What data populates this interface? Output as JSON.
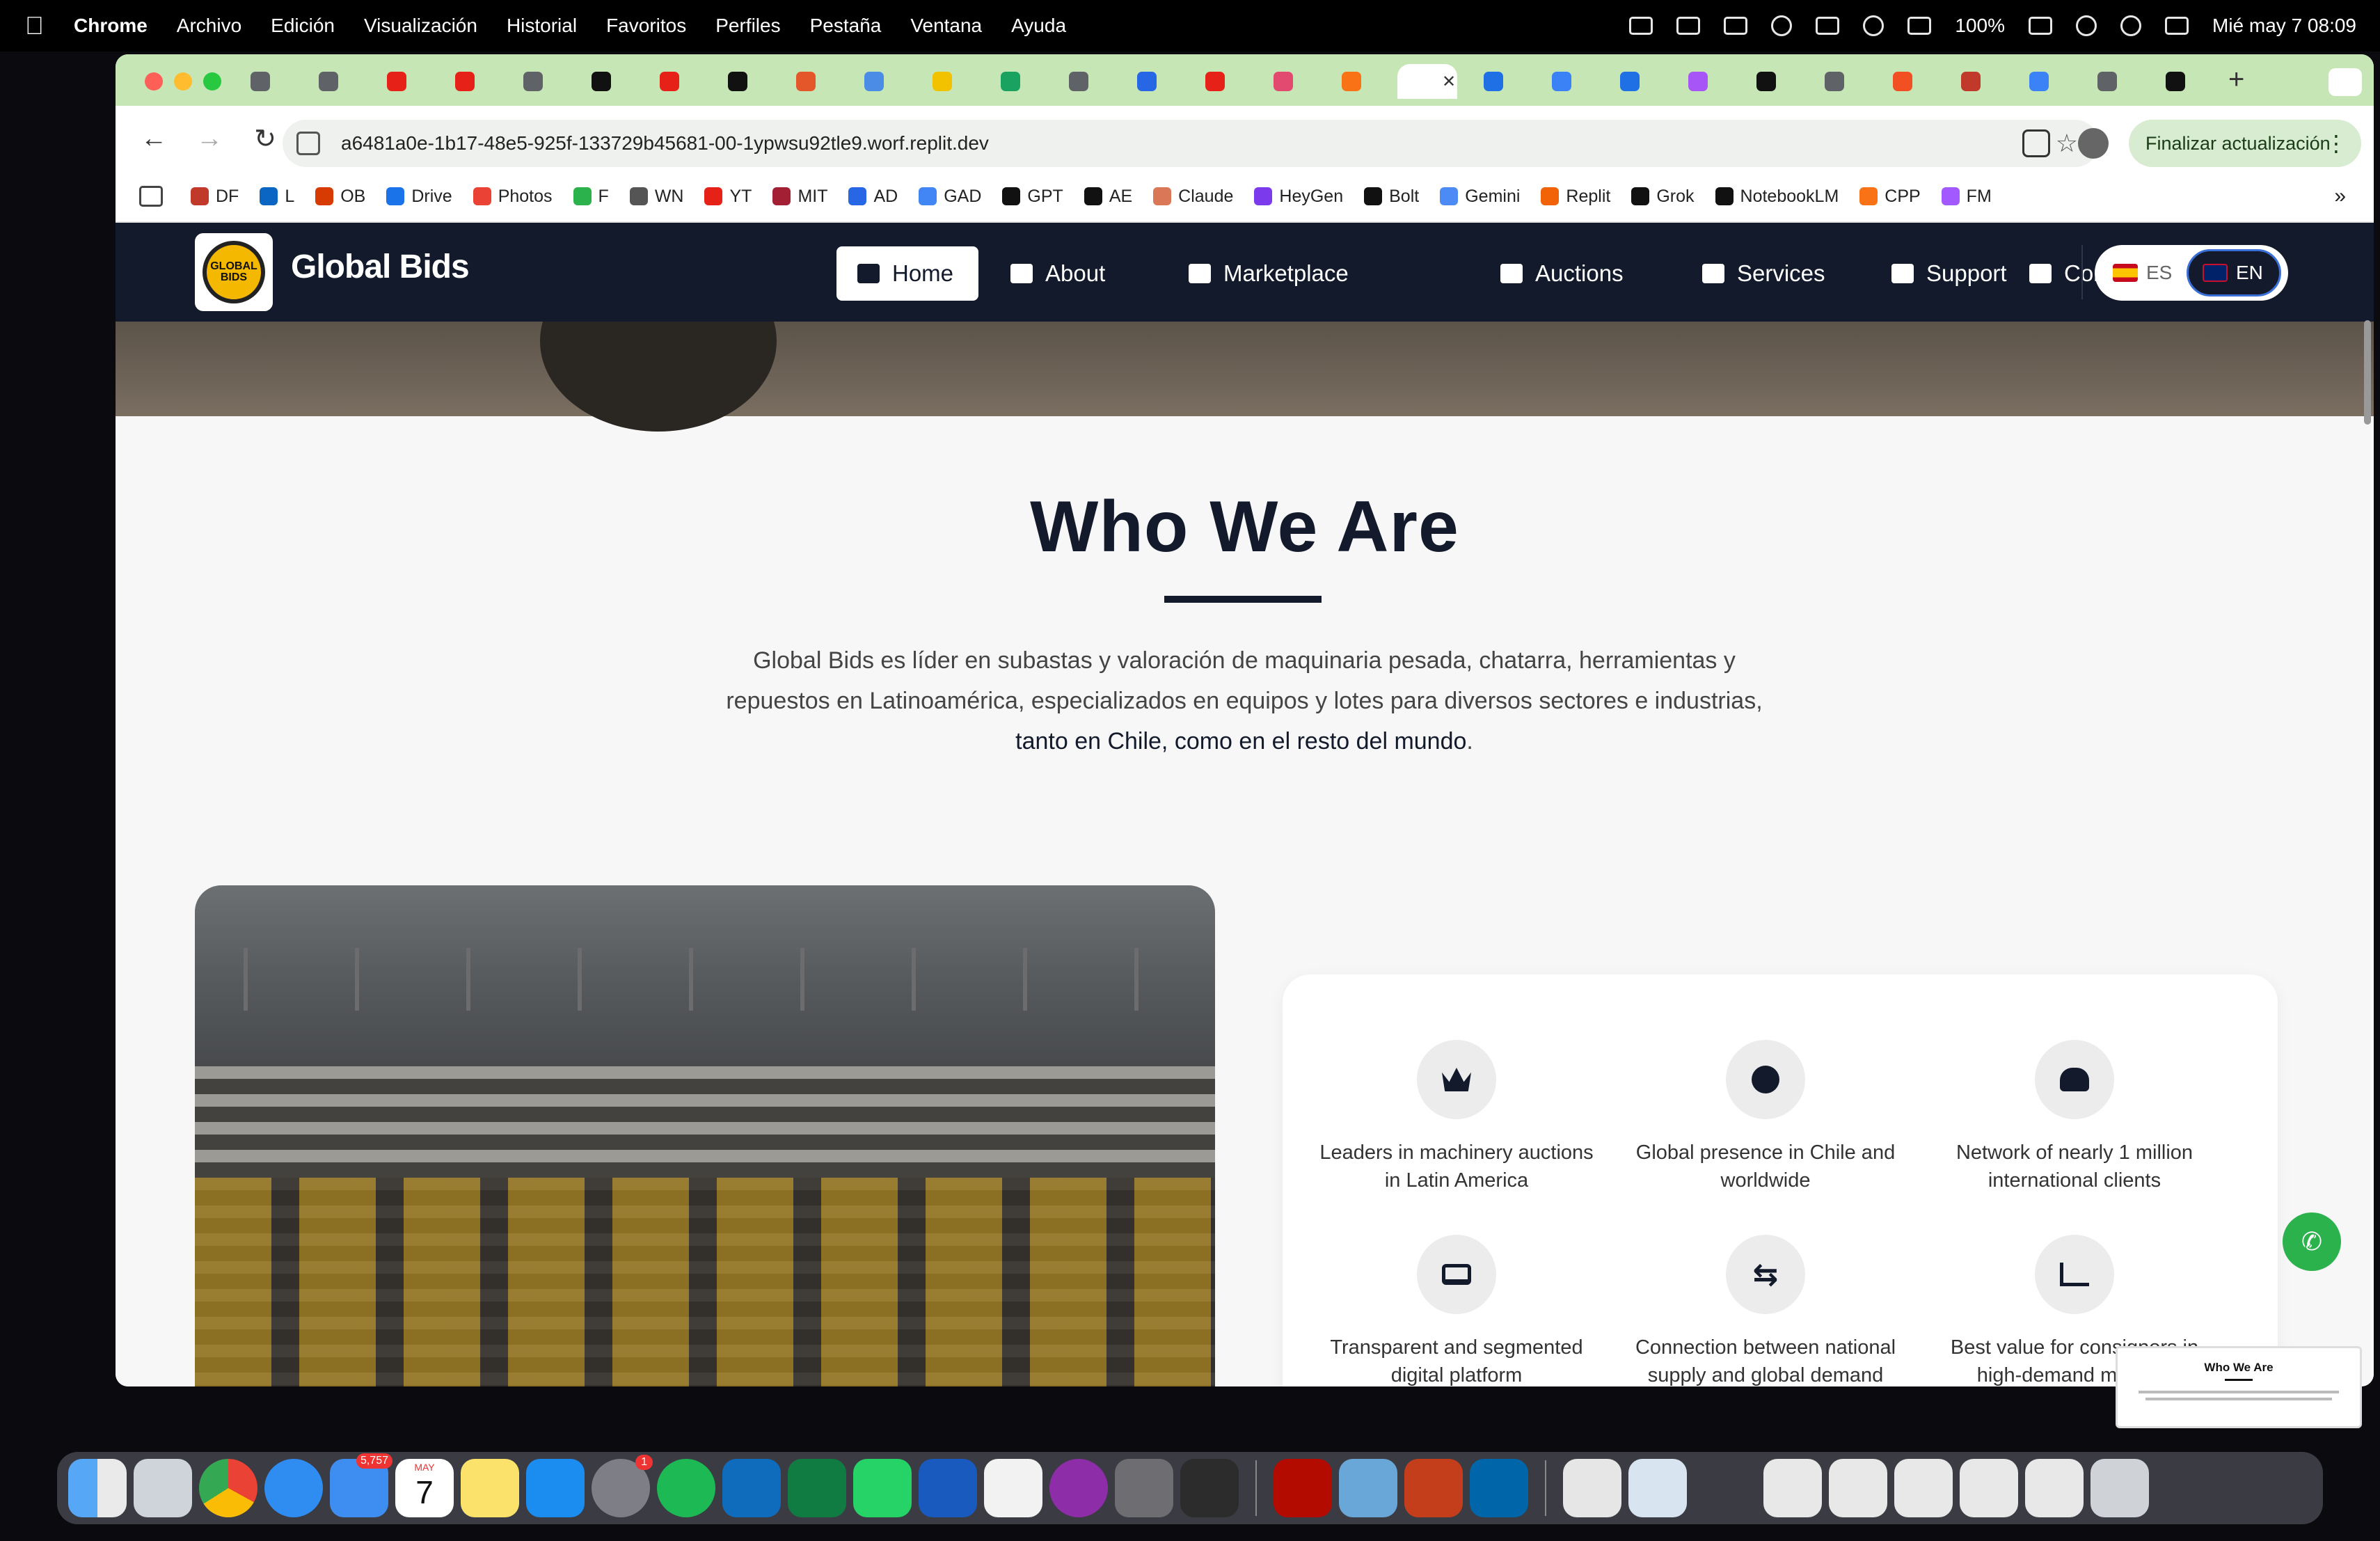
{
  "menubar": {
    "app": "Chrome",
    "items": [
      "Archivo",
      "Edición",
      "Visualización",
      "Historial",
      "Favoritos",
      "Perfiles",
      "Pestaña",
      "Ventana",
      "Ayuda"
    ],
    "battery": "100%",
    "datetime": "Mié may 7  08:09"
  },
  "browser": {
    "url": "a6481a0e-1b17-48e5-925f-133729b45681-00-1ypwsu92tle9.worf.replit.dev",
    "update_label": "Finalizar actualización",
    "bookmarks": [
      "DF",
      "L",
      "OB",
      "Drive",
      "Photos",
      "F",
      "WN",
      "YT",
      "MIT",
      "AD",
      "GAD",
      "GPT",
      "AE",
      "Claude",
      "HeyGen",
      "Bolt",
      "Gemini",
      "Replit",
      "Grok",
      "NotebookLM",
      "CPP",
      "FM"
    ]
  },
  "site": {
    "brand": "Global Bids",
    "logo_text": "GLOBAL BIDS",
    "nav": [
      "Home",
      "About",
      "Marketplace",
      "Auctions",
      "Services",
      "Support",
      "Contact"
    ],
    "lang": {
      "es": "ES",
      "en": "EN"
    },
    "title": "Who We Are",
    "desc_plain": "Global Bids es líder en subastas y valoración de maquinaria pesada, chatarra, herramientas y repuestos en Latinoamérica, especializados en equipos y lotes para diversos sectores e industrias, ",
    "desc_bold": "tanto en Chile, como en el resto del mundo",
    "desc_end": ".",
    "features": [
      {
        "icon": "crown-icon",
        "text": "Leaders in machinery auctions in Latin America"
      },
      {
        "icon": "globe-icon",
        "text": "Global presence in Chile and worldwide"
      },
      {
        "icon": "users-icon",
        "text": "Network of nearly 1 million international clients"
      },
      {
        "icon": "laptop-icon",
        "text": "Transparent and segmented digital platform"
      },
      {
        "icon": "exchange-icon",
        "text": "Connection between national supply and global demand"
      },
      {
        "icon": "chart-line-icon",
        "text": "Best value for consignors in high-demand markets"
      }
    ],
    "thumbnail_title": "Who We Are"
  },
  "dock": {
    "mail_badge": "5,757",
    "calendar_month": "MAY",
    "calendar_day": "7",
    "settings_badge": "1"
  }
}
